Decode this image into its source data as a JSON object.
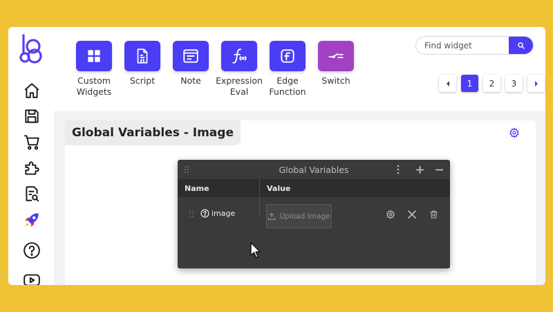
{
  "colors": {
    "accent": "#4a3df3",
    "switch": "#a341c4",
    "backdrop": "#f0c235",
    "dialog": "#3a3a3a"
  },
  "sidebar": {
    "logo": "loop-logo-icon",
    "items": [
      {
        "icon": "home-icon"
      },
      {
        "icon": "save-icon"
      },
      {
        "icon": "cart-icon"
      },
      {
        "icon": "puzzle-icon"
      },
      {
        "icon": "document-search-icon"
      },
      {
        "icon": "rocket-icon"
      },
      {
        "icon": "help-icon"
      },
      {
        "icon": "youtube-icon"
      }
    ]
  },
  "widgets": [
    {
      "label": "Custom Widgets",
      "icon": "grid-icon"
    },
    {
      "label": "Script",
      "icon": "script-file-icon"
    },
    {
      "label": "Note",
      "icon": "note-icon"
    },
    {
      "label": "Expression Eval",
      "icon": "function-icon"
    },
    {
      "label": "Edge Function",
      "icon": "edge-function-icon"
    },
    {
      "label": "Switch",
      "icon": "switch-icon"
    }
  ],
  "search": {
    "placeholder": "Find widget"
  },
  "pagination": {
    "pages": [
      "1",
      "2",
      "3"
    ],
    "current": "1"
  },
  "panel": {
    "title": "Global Variables - Image"
  },
  "dialog": {
    "title": "Global Variables",
    "columns": {
      "name": "Name",
      "value": "Value"
    },
    "rows": [
      {
        "name": "image",
        "upload_label": "Upload Image"
      }
    ]
  }
}
